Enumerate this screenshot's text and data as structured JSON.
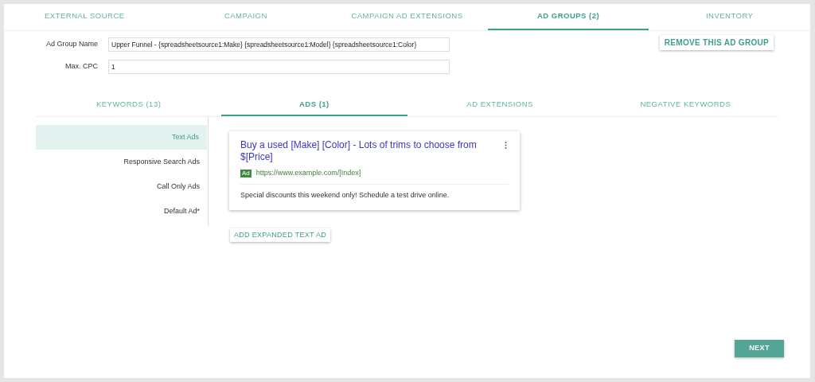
{
  "tabs": [
    {
      "label": "EXTERNAL SOURCE",
      "selected": false
    },
    {
      "label": "CAMPAIGN",
      "selected": false
    },
    {
      "label": "CAMPAIGN AD EXTENSIONS",
      "selected": false
    },
    {
      "label": "AD GROUPS (2)",
      "selected": true
    },
    {
      "label": "INVENTORY",
      "selected": false
    }
  ],
  "fields": [
    {
      "label": "Ad Group Name",
      "value": "Upper Funnel - {spreadsheetsource1:Make} {spreadsheetsource1:Model} {spreadsheetsource1:Color}"
    },
    {
      "label": "Max. CPC",
      "value": "1"
    }
  ],
  "remove_button": "REMOVE THIS AD GROUP",
  "subtabs": [
    {
      "label": "KEYWORDS (13)",
      "selected": false
    },
    {
      "label": "ADS (1)",
      "selected": true
    },
    {
      "label": "AD EXTENSIONS",
      "selected": false
    },
    {
      "label": "NEGATIVE KEYWORDS",
      "selected": false
    }
  ],
  "sidebar": {
    "items": [
      {
        "label": "Text Ads",
        "selected": true
      },
      {
        "label": "Responsive Search Ads",
        "selected": false
      },
      {
        "label": "Call Only Ads",
        "selected": false
      },
      {
        "label": "Default Ad*",
        "selected": false
      }
    ]
  },
  "ad": {
    "headline": "Buy a used [Make] [Color] - Lots of trims to choose from $[Price]",
    "badge": "Ad",
    "url": "https://www.example.com/[Index]",
    "description": "Special discounts this weekend only! Schedule a test drive online."
  },
  "add_button": "ADD EXPANDED TEXT AD",
  "next_button": "NEXT"
}
